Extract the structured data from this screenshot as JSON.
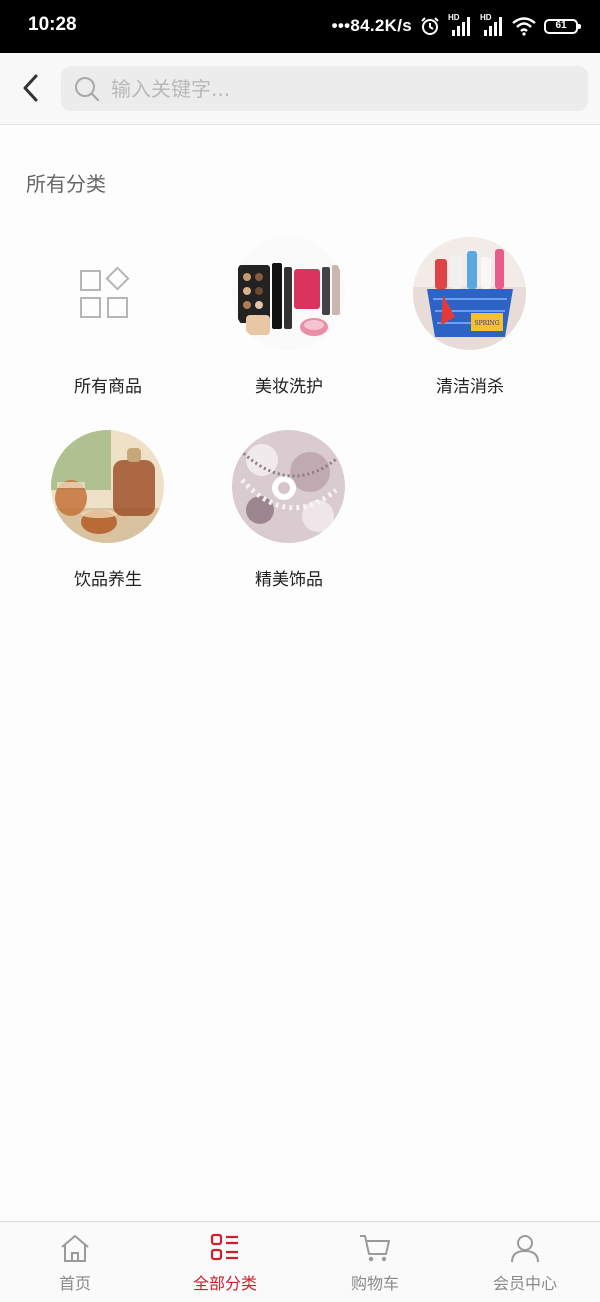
{
  "status_bar": {
    "time": "10:28",
    "network_speed": "•••84.2K/s",
    "signal_label_1": "HD",
    "signal_label_2": "HD",
    "battery": "61",
    "icons": [
      "alarm-icon",
      "signal-icon",
      "signal-icon",
      "wifi-icon",
      "battery-icon"
    ]
  },
  "header": {
    "back_icon": "chevron-left-icon",
    "search": {
      "placeholder": "输入关键字...",
      "value": "",
      "icon": "search-icon"
    }
  },
  "main": {
    "section_title": "所有分类",
    "categories": [
      {
        "label": "所有商品",
        "icon": "grid-icon"
      },
      {
        "label": "美妆洗护",
        "image": "cosmetics-image"
      },
      {
        "label": "清洁消杀",
        "image": "cleaning-supplies-image"
      },
      {
        "label": "饮品养生",
        "image": "tea-drinks-image"
      },
      {
        "label": "精美饰品",
        "image": "jewelry-image"
      }
    ]
  },
  "tab_bar": {
    "active_color": "#d0202e",
    "inactive_color": "#8a8a8a",
    "tabs": [
      {
        "label": "首页",
        "icon": "home-icon",
        "active": false
      },
      {
        "label": "全部分类",
        "icon": "category-list-icon",
        "active": true
      },
      {
        "label": "购物车",
        "icon": "cart-icon",
        "active": false
      },
      {
        "label": "会员中心",
        "icon": "user-icon",
        "active": false
      }
    ]
  }
}
